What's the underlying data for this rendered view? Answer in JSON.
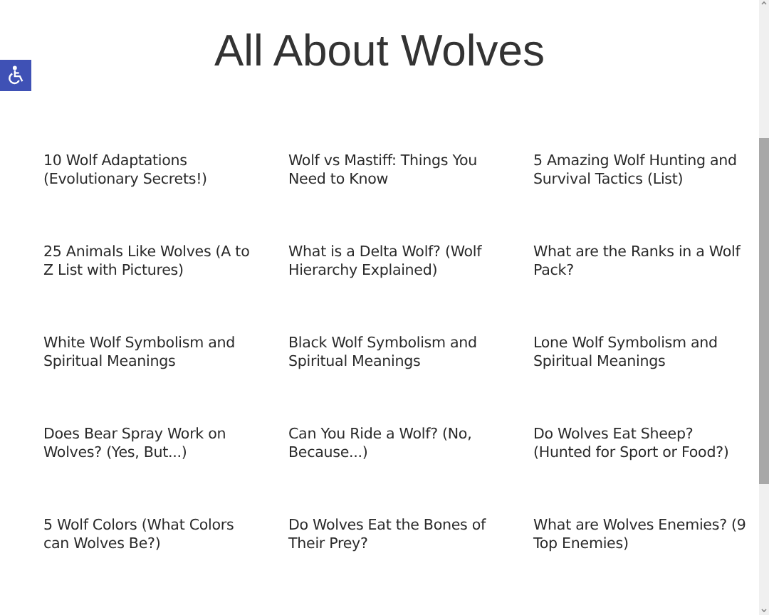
{
  "page": {
    "title": "All About Wolves"
  },
  "articles": [
    {
      "title": "10 Wolf Adaptations (Evolutionary Secrets!)"
    },
    {
      "title": "Wolf vs Mastiff: Things You Need to Know"
    },
    {
      "title": "5 Amazing Wolf Hunting and Survival Tactics (List)"
    },
    {
      "title": "25 Animals Like Wolves (A to Z List with Pictures)"
    },
    {
      "title": "What is a Delta Wolf? (Wolf Hierarchy Explained)"
    },
    {
      "title": "What are the Ranks in a Wolf Pack?"
    },
    {
      "title": "White Wolf Symbolism and Spiritual Meanings"
    },
    {
      "title": "Black Wolf Symbolism and Spiritual Meanings"
    },
    {
      "title": "Lone Wolf Symbolism and Spiritual Meanings"
    },
    {
      "title": "Does Bear Spray Work on Wolves? (Yes, But...)"
    },
    {
      "title": "Can You Ride a Wolf? (No, Because...)"
    },
    {
      "title": "Do Wolves Eat Sheep? (Hunted for Sport or Food?)"
    },
    {
      "title": "5 Wolf Colors (What Colors can Wolves Be?)"
    },
    {
      "title": "Do Wolves Eat the Bones of Their Prey?"
    },
    {
      "title": "What are Wolves Enemies? (9 Top Enemies)"
    }
  ]
}
